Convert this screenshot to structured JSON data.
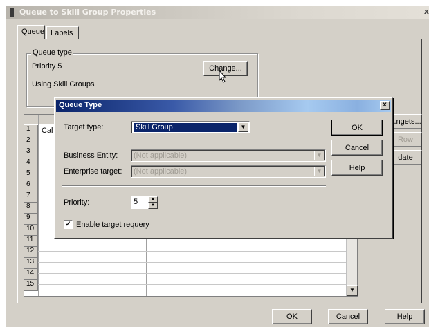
{
  "window": {
    "title": "Queue to Skill Group Properties",
    "close_glyph": "x"
  },
  "tabs": [
    {
      "label": "Queue"
    },
    {
      "label": "Labels"
    }
  ],
  "queue_type": {
    "legend": "Queue type",
    "priority_text": "Priority 5",
    "mode_text": "Using Skill Groups",
    "change_button": "Change..."
  },
  "grid": {
    "row_numbers": [
      "1",
      "2",
      "3",
      "4",
      "5",
      "6",
      "7",
      "8",
      "9",
      "10",
      "11",
      "12",
      "13",
      "14",
      "15"
    ],
    "first_cell_partial": "Cal"
  },
  "side_buttons": {
    "targets": "...ngets...",
    "row": "Row",
    "update": "date"
  },
  "footer": {
    "ok": "OK",
    "cancel": "Cancel",
    "help": "Help"
  },
  "dialog": {
    "title": "Queue Type",
    "close_glyph": "x",
    "target_type_label": "Target type:",
    "target_type_value": "Skill Group",
    "business_entity_label": "Business Entity:",
    "business_entity_value": "(Not applicable)",
    "enterprise_target_label": "Enterprise target:",
    "enterprise_target_value": "(Not applicable)",
    "priority_label": "Priority:",
    "priority_value": "5",
    "requery_label": "Enable target requery",
    "requery_checked": true,
    "ok": "OK",
    "cancel": "Cancel",
    "help": "Help"
  }
}
